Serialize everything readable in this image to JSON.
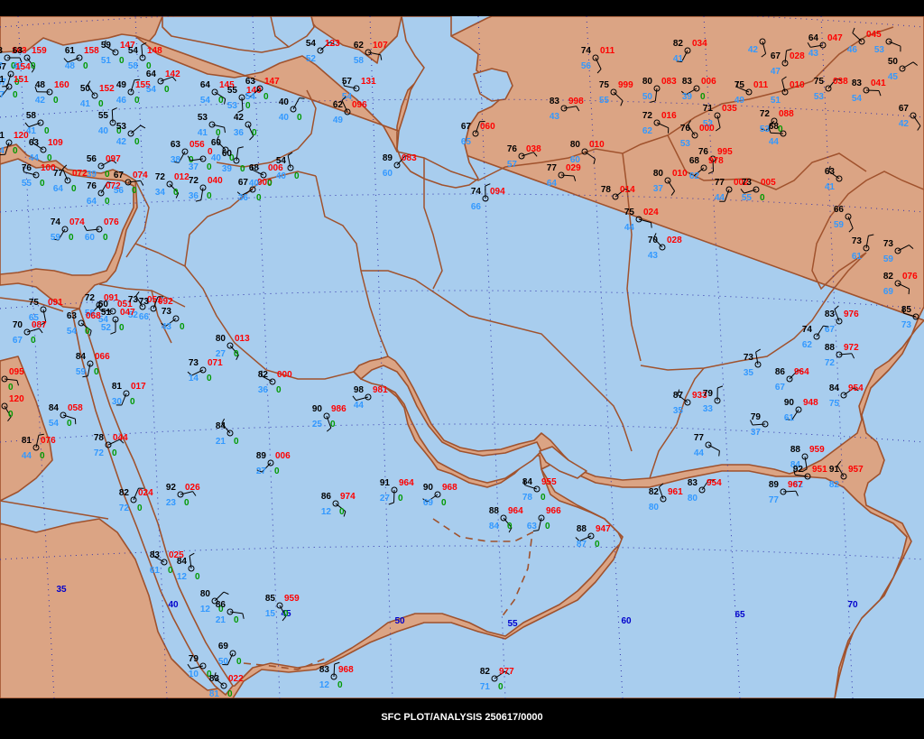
{
  "footer": "SFC PLOT/ANALYSIS 250617/0000",
  "colors": {
    "sea": "#a8cdee",
    "land": "#dba484",
    "border": "#a0522d",
    "temp": "#000000",
    "pressure": "#ff0000",
    "dewpoint": "#3399ff",
    "visibility": "#009900",
    "grid": "#3333aa",
    "meridian_label": "#0000cc"
  },
  "meridian_labels": [
    "35",
    "40",
    "45",
    "50",
    "55",
    "60",
    "65",
    "70"
  ],
  "stations": [
    {
      "t": "63",
      "p": "163",
      "d": "47",
      "v": "0"
    },
    {
      "t": "63",
      "p": "159",
      "d": "47",
      "v": "0"
    },
    {
      "t": "67",
      "p": "154",
      "d": "47",
      "v": "0"
    },
    {
      "t": "61",
      "p": "158",
      "d": "48",
      "v": "0"
    },
    {
      "t": "59",
      "p": "147",
      "d": "51",
      "v": "0"
    },
    {
      "t": "54",
      "p": "148",
      "d": "58",
      "v": "0"
    },
    {
      "t": "54",
      "p": "123",
      "d": "52",
      "v": ""
    },
    {
      "t": "62",
      "p": "107",
      "d": "58",
      "v": ""
    },
    {
      "t": "74",
      "p": "011",
      "d": "56",
      "v": ""
    },
    {
      "t": "82",
      "p": "034",
      "d": "41",
      "v": ""
    },
    {
      "t": "64",
      "p": "047",
      "d": "43",
      "v": ""
    },
    {
      "t": "",
      "p": "045",
      "d": "46",
      "v": ""
    },
    {
      "t": "67",
      "p": "028",
      "d": "47",
      "v": ""
    },
    {
      "t": "50",
      "p": "",
      "d": "45",
      "v": ""
    },
    {
      "t": "",
      "p": "",
      "d": "53",
      "v": ""
    },
    {
      "t": "",
      "p": "",
      "d": "42",
      "v": ""
    },
    {
      "t": "71",
      "p": "151",
      "d": "47",
      "v": "0"
    },
    {
      "t": "48",
      "p": "160",
      "d": "42",
      "v": "0"
    },
    {
      "t": "50",
      "p": "152",
      "d": "41",
      "v": "0"
    },
    {
      "t": "49",
      "p": "155",
      "d": "46",
      "v": "0"
    },
    {
      "t": "64",
      "p": "142",
      "d": "54",
      "v": "0"
    },
    {
      "t": "64",
      "p": "145",
      "d": "54",
      "v": "0"
    },
    {
      "t": "55",
      "p": "140",
      "d": "53",
      "v": "0"
    },
    {
      "t": "63",
      "p": "147",
      "d": "54",
      "v": "0"
    },
    {
      "t": "57",
      "p": "131",
      "d": "54",
      "v": ""
    },
    {
      "t": "62",
      "p": "096",
      "d": "49",
      "v": ""
    },
    {
      "t": "40",
      "p": "",
      "d": "40",
      "v": "0"
    },
    {
      "t": "83",
      "p": "998",
      "d": "43",
      "v": ""
    },
    {
      "t": "75",
      "p": "999",
      "d": "55",
      "v": ""
    },
    {
      "t": "80",
      "p": "083",
      "d": "50",
      "v": ""
    },
    {
      "t": "83",
      "p": "006",
      "d": "39",
      "v": "0"
    },
    {
      "t": "75",
      "p": "011",
      "d": "49",
      "v": ""
    },
    {
      "t": "",
      "p": "010",
      "d": "51",
      "v": ""
    },
    {
      "t": "75",
      "p": "038",
      "d": "53",
      "v": ""
    },
    {
      "t": "83",
      "p": "041",
      "d": "54",
      "v": ""
    },
    {
      "t": "67",
      "p": "",
      "d": "42",
      "v": ""
    },
    {
      "t": "71",
      "p": "120",
      "d": "44",
      "v": "0"
    },
    {
      "t": "58",
      "p": "",
      "d": "41",
      "v": "0"
    },
    {
      "t": "63",
      "p": "109",
      "d": "44",
      "v": "0"
    },
    {
      "t": "55",
      "p": "",
      "d": "40",
      "v": "0"
    },
    {
      "t": "53",
      "p": "",
      "d": "42",
      "v": "0"
    },
    {
      "t": "53",
      "p": "",
      "d": "41",
      "v": "0"
    },
    {
      "t": "42",
      "p": "",
      "d": "36",
      "v": "0"
    },
    {
      "t": "63",
      "p": "056",
      "d": "38",
      "v": "0"
    },
    {
      "t": "",
      "p": "0",
      "d": "37",
      "v": "0"
    },
    {
      "t": "60",
      "p": "",
      "d": "40",
      "v": "0"
    },
    {
      "t": "60",
      "p": "",
      "d": "39",
      "v": "0"
    },
    {
      "t": "56",
      "p": "097",
      "d": "39",
      "v": "0"
    },
    {
      "t": "72",
      "p": "016",
      "d": "62",
      "v": ""
    },
    {
      "t": "71",
      "p": "035",
      "d": "53",
      "v": ""
    },
    {
      "t": "72",
      "p": "088",
      "d": "53",
      "v": "0"
    },
    {
      "t": "68",
      "p": "",
      "d": "44",
      "v": ""
    },
    {
      "t": "76",
      "p": "000",
      "d": "53",
      "v": ""
    },
    {
      "t": "67",
      "p": "060",
      "d": "65",
      "v": ""
    },
    {
      "t": "76",
      "p": "038",
      "d": "57",
      "v": ""
    },
    {
      "t": "80",
      "p": "010",
      "d": "60",
      "v": ""
    },
    {
      "t": "76",
      "p": "995",
      "d": "",
      "v": ""
    },
    {
      "t": "68",
      "p": "978",
      "d": "62",
      "v": ""
    },
    {
      "t": "76",
      "p": "100",
      "d": "55",
      "v": "0"
    },
    {
      "t": "77",
      "p": "072",
      "d": "64",
      "v": "0"
    },
    {
      "t": "76",
      "p": "072",
      "d": "64",
      "v": "0"
    },
    {
      "t": "67",
      "p": "074",
      "d": "56",
      "v": "0"
    },
    {
      "t": "72",
      "p": "012",
      "d": "34",
      "v": "0"
    },
    {
      "t": "72",
      "p": "040",
      "d": "36",
      "v": "0"
    },
    {
      "t": "67",
      "p": "000",
      "d": "36",
      "v": "0"
    },
    {
      "t": "68",
      "p": "006",
      "d": "40",
      "v": "0"
    },
    {
      "t": "54",
      "p": "",
      "d": "40",
      "v": "0"
    },
    {
      "t": "89",
      "p": "083",
      "d": "60",
      "v": ""
    },
    {
      "t": "77",
      "p": "029",
      "d": "64",
      "v": ""
    },
    {
      "t": "80",
      "p": "010",
      "d": "37",
      "v": ""
    },
    {
      "t": "77",
      "p": "002",
      "d": "44",
      "v": ""
    },
    {
      "t": "73",
      "p": "005",
      "d": "55",
      "v": "0"
    },
    {
      "t": "63",
      "p": "",
      "d": "41",
      "v": ""
    },
    {
      "t": "74",
      "p": "094",
      "d": "66",
      "v": ""
    },
    {
      "t": "78",
      "p": "014",
      "d": "",
      "v": ""
    },
    {
      "t": "75",
      "p": "024",
      "d": "44",
      "v": ""
    },
    {
      "t": "66",
      "p": "",
      "d": "59",
      "v": ""
    },
    {
      "t": "74",
      "p": "074",
      "d": "59",
      "v": "0"
    },
    {
      "t": "",
      "p": "076",
      "d": "60",
      "v": "0"
    },
    {
      "t": "70",
      "p": "028",
      "d": "43",
      "v": ""
    },
    {
      "t": "73",
      "p": "",
      "d": "61",
      "v": ""
    },
    {
      "t": "73",
      "p": "",
      "d": "59",
      "v": ""
    },
    {
      "t": "82",
      "p": "076",
      "d": "69",
      "v": ""
    },
    {
      "t": "75",
      "p": "091",
      "d": "65",
      "v": ""
    },
    {
      "t": "72",
      "p": "091",
      "d": "58",
      "v": ""
    },
    {
      "t": "60",
      "p": "051",
      "d": "54",
      "v": ""
    },
    {
      "t": "73",
      "p": "051",
      "d": "52",
      "v": ""
    },
    {
      "t": "73",
      "p": "092",
      "d": "66",
      "v": ""
    },
    {
      "t": "70",
      "p": "087",
      "d": "67",
      "v": "0"
    },
    {
      "t": "63",
      "p": "068",
      "d": "54",
      "v": "0"
    },
    {
      "t": "51",
      "p": "047",
      "d": "52",
      "v": "0"
    },
    {
      "t": "73",
      "p": "",
      "d": "43",
      "v": "0"
    },
    {
      "t": "85",
      "p": "",
      "d": "73",
      "v": ""
    },
    {
      "t": "83",
      "p": "976",
      "d": "67",
      "v": ""
    },
    {
      "t": "74",
      "p": "",
      "d": "62",
      "v": ""
    },
    {
      "t": "88",
      "p": "972",
      "d": "72",
      "v": ""
    },
    {
      "t": "80",
      "p": "013",
      "d": "27",
      "v": "0"
    },
    {
      "t": "84",
      "p": "066",
      "d": "59",
      "v": "0"
    },
    {
      "t": "73",
      "p": "071",
      "d": "14",
      "v": "0"
    },
    {
      "t": "82",
      "p": "000",
      "d": "36",
      "v": "0"
    },
    {
      "t": "73",
      "p": "",
      "d": "35",
      "v": ""
    },
    {
      "t": "86",
      "p": "964",
      "d": "67",
      "v": ""
    },
    {
      "t": "",
      "p": "095",
      "d": "",
      "v": "0"
    },
    {
      "t": "",
      "p": "120",
      "d": "",
      "v": "0"
    },
    {
      "t": "81",
      "p": "017",
      "d": "30",
      "v": "0"
    },
    {
      "t": "98",
      "p": "981",
      "d": "44",
      "v": ""
    },
    {
      "t": "87",
      "p": "933",
      "d": "35",
      "v": ""
    },
    {
      "t": "79",
      "p": "",
      "d": "33",
      "v": ""
    },
    {
      "t": "84",
      "p": "954",
      "d": "75",
      "v": ""
    },
    {
      "t": "84",
      "p": "058",
      "d": "54",
      "v": "0"
    },
    {
      "t": "90",
      "p": "986",
      "d": "25",
      "v": "0"
    },
    {
      "t": "90",
      "p": "948",
      "d": "61",
      "v": ""
    },
    {
      "t": "79",
      "p": "",
      "d": "37",
      "v": ""
    },
    {
      "t": "84",
      "p": "",
      "d": "21",
      "v": "0"
    },
    {
      "t": "81",
      "p": "076",
      "d": "44",
      "v": "0"
    },
    {
      "t": "78",
      "p": "044",
      "d": "72",
      "v": "0"
    },
    {
      "t": "77",
      "p": "",
      "d": "44",
      "v": ""
    },
    {
      "t": "88",
      "p": "959",
      "d": "84",
      "v": ""
    },
    {
      "t": "89",
      "p": "006",
      "d": "27",
      "v": "0"
    },
    {
      "t": "92",
      "p": "951",
      "d": "82",
      "v": ""
    },
    {
      "t": "91",
      "p": "957",
      "d": "82",
      "v": ""
    },
    {
      "t": "82",
      "p": "024",
      "d": "72",
      "v": "0"
    },
    {
      "t": "92",
      "p": "026",
      "d": "23",
      "v": "0"
    },
    {
      "t": "86",
      "p": "974",
      "d": "12",
      "v": "0"
    },
    {
      "t": "91",
      "p": "964",
      "d": "27",
      "v": "0"
    },
    {
      "t": "90",
      "p": "968",
      "d": "69",
      "v": "0"
    },
    {
      "t": "84",
      "p": "955",
      "d": "78",
      "v": "0"
    },
    {
      "t": "82",
      "p": "961",
      "d": "80",
      "v": ""
    },
    {
      "t": "83",
      "p": "954",
      "d": "80",
      "v": ""
    },
    {
      "t": "89",
      "p": "967",
      "d": "77",
      "v": ""
    },
    {
      "t": "88",
      "p": "964",
      "d": "84",
      "v": "0"
    },
    {
      "t": "",
      "p": "966",
      "d": "63",
      "v": "0"
    },
    {
      "t": "88",
      "p": "947",
      "d": "87",
      "v": "0"
    },
    {
      "t": "83",
      "p": "025",
      "d": "61",
      "v": "0"
    },
    {
      "t": "84",
      "p": "",
      "d": "12",
      "v": "0"
    },
    {
      "t": "80",
      "p": "",
      "d": "12",
      "v": "0"
    },
    {
      "t": "86",
      "p": "",
      "d": "21",
      "v": "0"
    },
    {
      "t": "85",
      "p": "959",
      "d": "15",
      "v": "0"
    },
    {
      "t": "69",
      "p": "",
      "d": "50",
      "v": "0"
    },
    {
      "t": "79",
      "p": "",
      "d": "10",
      "v": "0"
    },
    {
      "t": "83",
      "p": "022",
      "d": "81",
      "v": "0"
    },
    {
      "t": "83",
      "p": "968",
      "d": "12",
      "v": "0"
    },
    {
      "t": "82",
      "p": "977",
      "d": "71",
      "v": "0"
    }
  ]
}
